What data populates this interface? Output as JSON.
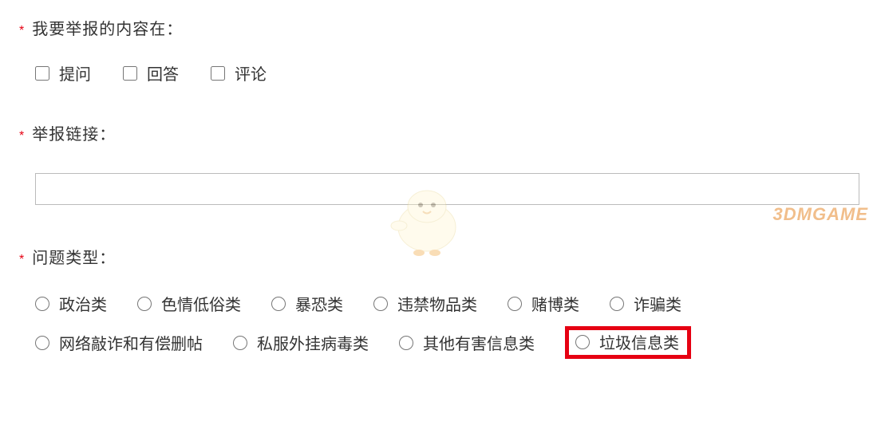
{
  "section1": {
    "label": "我要举报的内容在：",
    "options": [
      {
        "label": "提问"
      },
      {
        "label": "回答"
      },
      {
        "label": "评论"
      }
    ]
  },
  "section2": {
    "label": "举报链接：",
    "value": ""
  },
  "section3": {
    "label": "问题类型：",
    "row1": [
      {
        "label": "政治类"
      },
      {
        "label": "色情低俗类"
      },
      {
        "label": "暴恐类"
      },
      {
        "label": "违禁物品类"
      },
      {
        "label": "赌博类"
      },
      {
        "label": "诈骗类"
      }
    ],
    "row2": [
      {
        "label": "网络敲诈和有偿删帖"
      },
      {
        "label": "私服外挂病毒类"
      },
      {
        "label": "其他有害信息类"
      },
      {
        "label": "垃圾信息类",
        "highlighted": true
      }
    ]
  },
  "watermark": "3DMGAME"
}
